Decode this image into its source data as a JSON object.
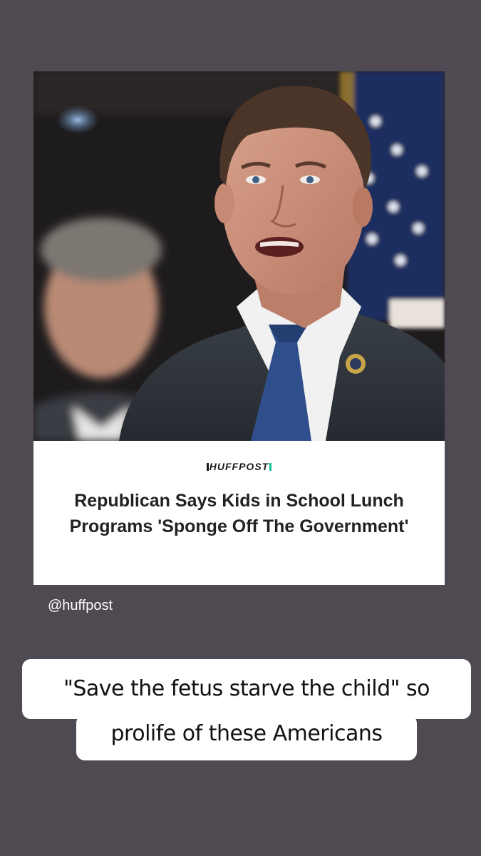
{
  "article": {
    "brand": "HUFFPOST",
    "headline": "Republican Says Kids in School Lunch Programs 'Sponge Off The Government'"
  },
  "handle": "@huffpost",
  "caption": {
    "line1": "\"Save the fetus starve the child\" so",
    "line2": "prolife of these Americans"
  },
  "colors": {
    "background": "#4f4a51",
    "brand_accent": "#0dbe98"
  }
}
